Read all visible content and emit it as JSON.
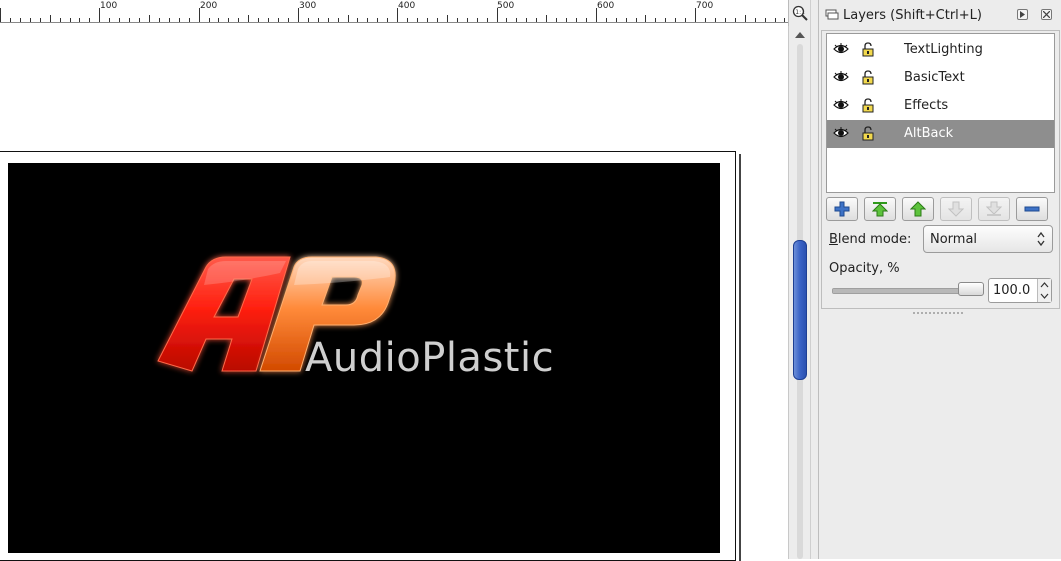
{
  "ruler": {
    "labels": [
      "100",
      "200",
      "300",
      "400",
      "500",
      "600",
      "700"
    ]
  },
  "zoom_button": {
    "icon": "zoom-fit-icon"
  },
  "canvas": {
    "brand_text": "AudioPlastic",
    "logo": "AP"
  },
  "dock": {
    "title": "Layers (Shift+Ctrl+L)",
    "layers": [
      {
        "name": "TextLighting",
        "visible": true,
        "locked": false,
        "selected": false
      },
      {
        "name": "BasicText",
        "visible": true,
        "locked": false,
        "selected": false
      },
      {
        "name": "Effects",
        "visible": true,
        "locked": false,
        "selected": false
      },
      {
        "name": "AltBack",
        "visible": true,
        "locked": false,
        "selected": true
      }
    ],
    "buttons": [
      {
        "icon": "add-icon",
        "enabled": true
      },
      {
        "icon": "raise-to-top-icon",
        "enabled": true
      },
      {
        "icon": "raise-icon",
        "enabled": true
      },
      {
        "icon": "lower-icon",
        "enabled": false
      },
      {
        "icon": "lower-to-bottom-icon",
        "enabled": false
      },
      {
        "icon": "remove-icon",
        "enabled": true
      }
    ],
    "blend_mode_label_first": "B",
    "blend_mode_label_rest": "lend mode:",
    "blend_mode_value": "Normal",
    "opacity_label": "Opacity, %",
    "opacity_value": "100.0",
    "opacity_fraction": 1.0
  },
  "colors": {
    "selected_row": "#8e8e8e",
    "scroll_thumb": "#3a63c6",
    "logo_red": "#ff2a1a",
    "logo_orange": "#ff7a20",
    "brand_text": "#cfcfcf"
  }
}
